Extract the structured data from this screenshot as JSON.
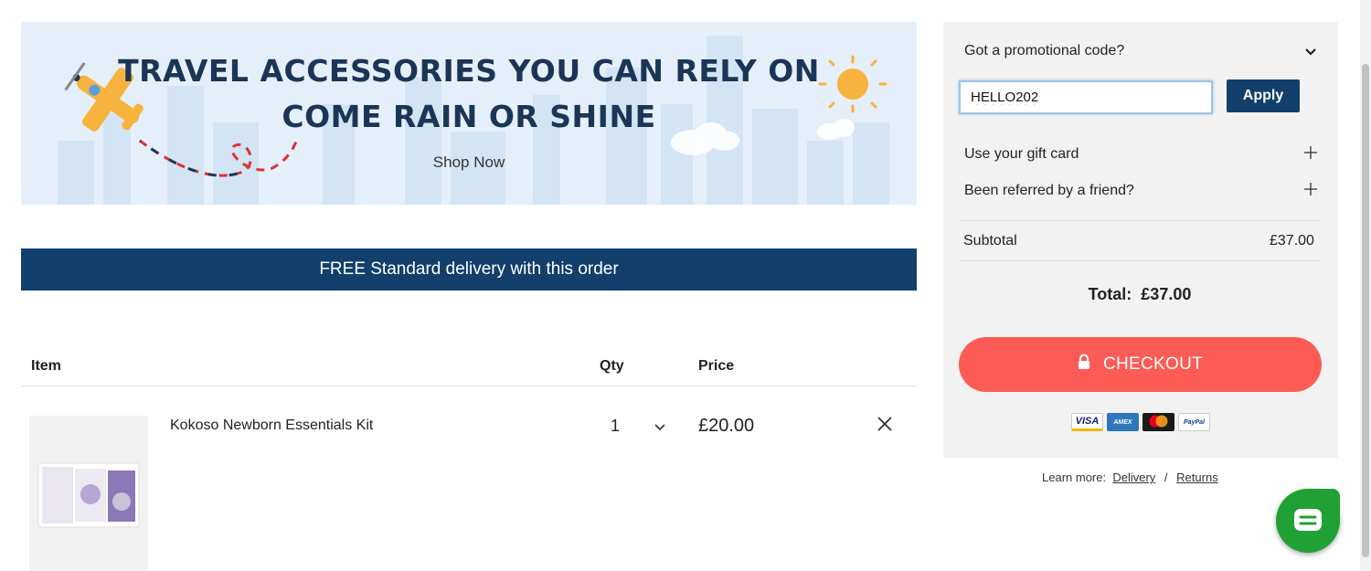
{
  "banner": {
    "line1": "TRAVEL ACCESSORIES YOU CAN RELY ON",
    "line2": "COME RAIN OR SHINE",
    "cta": "Shop Now"
  },
  "delivery": {
    "message": "FREE Standard delivery with this order"
  },
  "table": {
    "headers": {
      "item": "Item",
      "qty": "Qty",
      "price": "Price"
    },
    "rows": [
      {
        "name": "Kokoso Newborn Essentials Kit",
        "qty": "1",
        "price": "£20.00"
      }
    ]
  },
  "sidebar": {
    "promo": {
      "label": "Got a promotional code?",
      "value": "HELLO202",
      "apply_label": "Apply"
    },
    "gift_card_label": "Use your gift card",
    "referral_label": "Been referred by a friend?",
    "subtotal_label": "Subtotal",
    "subtotal_value": "£37.00",
    "total_label": "Total:",
    "total_value": "£37.00",
    "checkout_label": "CHECKOUT",
    "payment_methods": [
      "VISA",
      "AMERICAN EXPRESS",
      "mastercard",
      "PayPal"
    ]
  },
  "learn_more": {
    "label": "Learn more:",
    "delivery_link": "Delivery",
    "separator": "/",
    "returns_link": "Returns"
  },
  "colors": {
    "navy": "#123f6b",
    "checkout": "#fd5b55",
    "chat": "#21a036",
    "sidebar_bg": "#f2f2f2"
  },
  "icons": {
    "promo_toggle": "chevron-down-icon",
    "gift_toggle": "plus-icon",
    "referral_toggle": "plus-icon",
    "remove": "close-icon",
    "checkout": "lock-icon",
    "chat": "chat-icon"
  }
}
